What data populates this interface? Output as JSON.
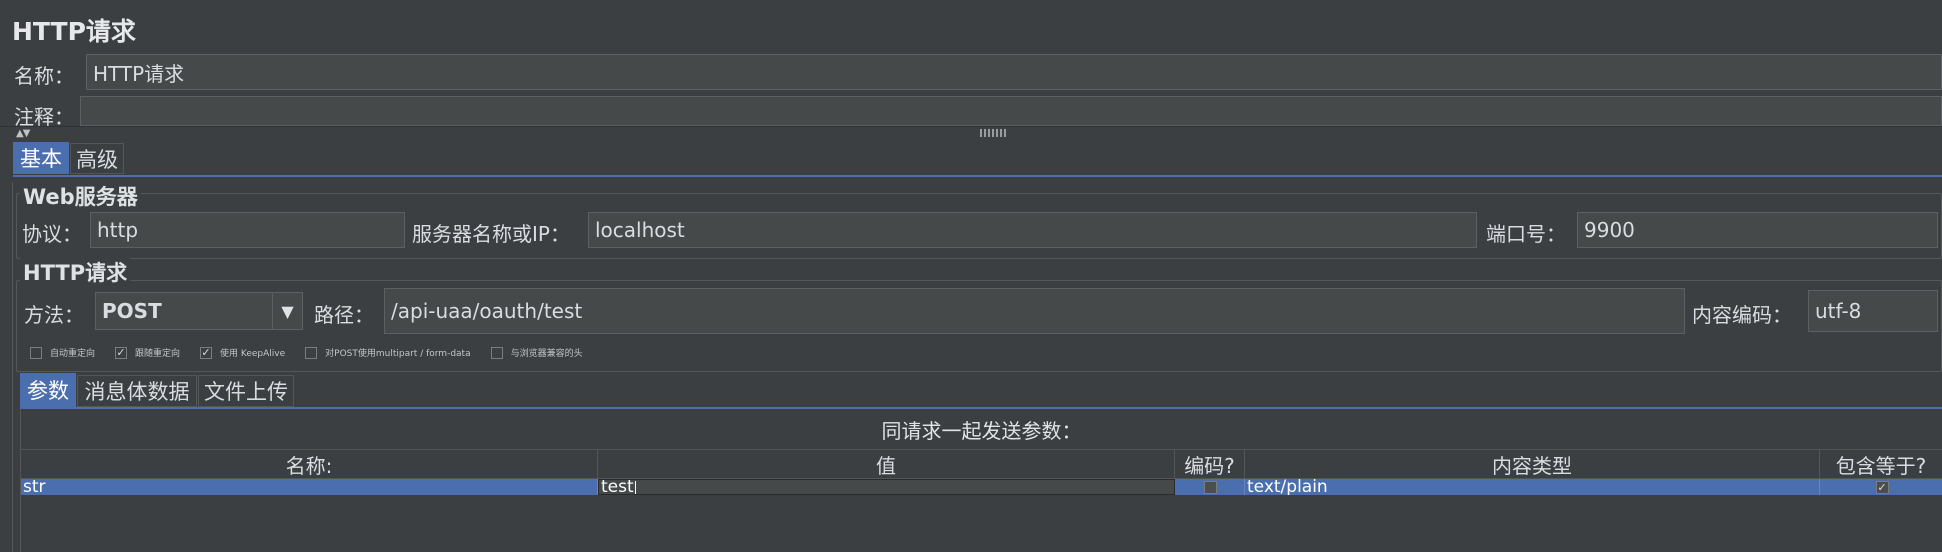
{
  "panel": {
    "title": "HTTP请求",
    "name_label": "名称：",
    "name_value": "HTTP请求",
    "comment_label": "注释：",
    "comment_value": ""
  },
  "main_tabs": [
    {
      "label": "基本",
      "active": true
    },
    {
      "label": "高级",
      "active": false
    }
  ],
  "web_server": {
    "title": "Web服务器",
    "protocol_label": "协议：",
    "protocol_value": "http",
    "server_label": "服务器名称或IP：",
    "server_value": "localhost",
    "port_label": "端口号：",
    "port_value": "9900"
  },
  "http_request": {
    "title": "HTTP请求",
    "method_label": "方法：",
    "method_value": "POST",
    "path_label": "路径：",
    "path_value": "/api-uaa/oauth/test",
    "encoding_label": "内容编码：",
    "encoding_value": "utf-8"
  },
  "options": [
    {
      "label": "自动重定向",
      "checked": false
    },
    {
      "label": "跟随重定向",
      "checked": true
    },
    {
      "label": "使用 KeepAlive",
      "checked": true
    },
    {
      "label": "对POST使用multipart / form-data",
      "checked": false
    },
    {
      "label": "与浏览器兼容的头",
      "checked": false
    }
  ],
  "sub_tabs": [
    {
      "label": "参数",
      "active": true
    },
    {
      "label": "消息体数据",
      "active": false
    },
    {
      "label": "文件上传",
      "active": false
    }
  ],
  "params": {
    "caption": "同请求一起发送参数：",
    "columns": [
      "名称:",
      "值",
      "编码?",
      "内容类型",
      "包含等于?"
    ],
    "rows": [
      {
        "name": "str",
        "value": "test",
        "encode": false,
        "content_type": "text/plain",
        "include_equals": true
      }
    ]
  },
  "colors": {
    "background": "#3c3f41",
    "accent": "#4b6eaf",
    "field": "#45494a"
  }
}
